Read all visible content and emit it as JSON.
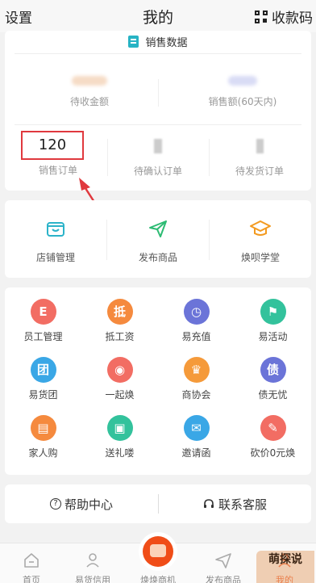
{
  "header": {
    "left": "设置",
    "title": "我的",
    "right": "收款码"
  },
  "sales": {
    "title": "销售数据",
    "metrics": [
      {
        "label": "待收金额"
      },
      {
        "label": "销售额(60天内)"
      }
    ],
    "orders": [
      {
        "value": "120",
        "label": "销售订单"
      },
      {
        "label": "待确认订单"
      },
      {
        "label": "待发货订单"
      }
    ]
  },
  "tools": [
    {
      "label": "店铺管理",
      "icon": "store-icon"
    },
    {
      "label": "发布商品",
      "icon": "paper-plane-icon"
    },
    {
      "label": "焕呗学堂",
      "icon": "graduation-cap-icon"
    }
  ],
  "grid": [
    {
      "label": "员工管理",
      "glyph": "E",
      "color": "#f26d63"
    },
    {
      "label": "抵工资",
      "glyph": "抵",
      "color": "#f58a3e"
    },
    {
      "label": "易充值",
      "glyph": "◷",
      "color": "#6b74d8"
    },
    {
      "label": "易活动",
      "glyph": "⚑",
      "color": "#33c29c"
    },
    {
      "label": "易货团",
      "glyph": "团",
      "color": "#3aa7e6"
    },
    {
      "label": "一起焕",
      "glyph": "◉",
      "color": "#f26d63"
    },
    {
      "label": "商协会",
      "glyph": "♛",
      "color": "#f59a3a"
    },
    {
      "label": "债无忧",
      "glyph": "债",
      "color": "#6b74d8"
    },
    {
      "label": "家人购",
      "glyph": "▤",
      "color": "#f58a3e"
    },
    {
      "label": "送礼喽",
      "glyph": "▣",
      "color": "#33c29c"
    },
    {
      "label": "邀请函",
      "glyph": "✉",
      "color": "#3aa7e6"
    },
    {
      "label": "砍价0元焕",
      "glyph": "✎",
      "color": "#f26d63"
    }
  ],
  "help": {
    "left": "帮助中心",
    "right": "联系客服"
  },
  "tabbar": [
    {
      "label": "首页"
    },
    {
      "label": "易货信用"
    },
    {
      "label": "焕焕商机"
    },
    {
      "label": "发布商品"
    },
    {
      "label": "我的"
    }
  ],
  "watermark": "萌探说"
}
